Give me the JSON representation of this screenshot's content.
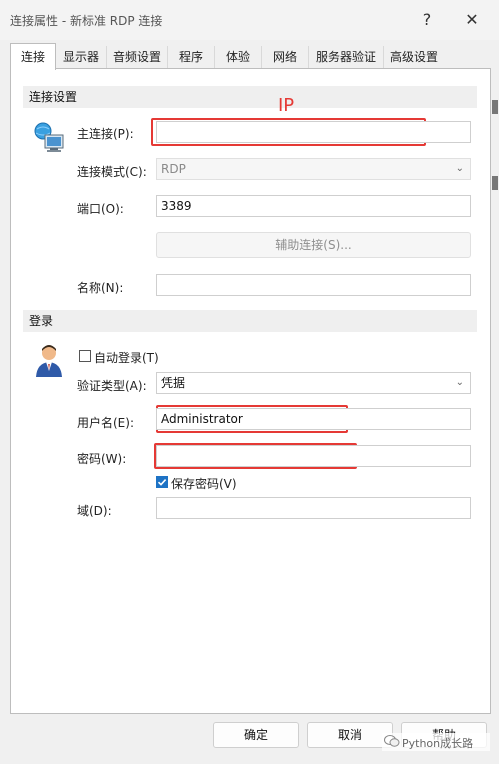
{
  "window": {
    "title": "连接属性 - 新标准 RDP 连接",
    "help_glyph": "?",
    "close_glyph": "✕"
  },
  "tabs": [
    {
      "label": "连接"
    },
    {
      "label": "显示器"
    },
    {
      "label": "音频设置"
    },
    {
      "label": "程序"
    },
    {
      "label": "体验"
    },
    {
      "label": "网络"
    },
    {
      "label": "服务器验证"
    },
    {
      "label": "高级设置"
    }
  ],
  "connection_section": {
    "heading": "连接设置",
    "annotation": "IP",
    "host_label": "主连接(P):",
    "host_value": "",
    "mode_label": "连接模式(C):",
    "mode_value": "RDP",
    "port_label": "端口(O):",
    "port_value": "3389",
    "aux_button": "辅助连接(S)...",
    "name_label": "名称(N):",
    "name_value": ""
  },
  "login_section": {
    "heading": "登录",
    "auto_login_label": "自动登录(T)",
    "auth_label": "验证类型(A):",
    "auth_value": "凭据",
    "user_label": "用户名(E):",
    "user_value": "Administrator",
    "password_label": "密码(W):",
    "password_value": "",
    "save_password_label": "保存密码(V)",
    "domain_label": "域(D):",
    "domain_value": ""
  },
  "footer": {
    "ok": "确定",
    "cancel": "取消",
    "help": "帮助",
    "watermark": "Python成长路"
  },
  "colors": {
    "annotation_red": "#e53935",
    "checkbox_blue": "#1e73c5"
  }
}
